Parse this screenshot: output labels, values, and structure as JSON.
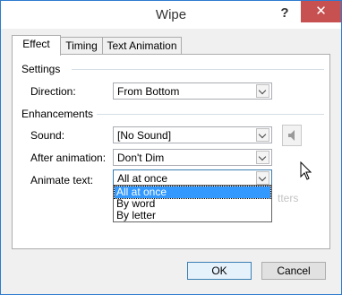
{
  "window": {
    "title": "Wipe",
    "help_label": "?",
    "close_label": "✕"
  },
  "tabs": [
    {
      "label": "Effect",
      "active": true
    },
    {
      "label": "Timing",
      "active": false
    },
    {
      "label": "Text Animation",
      "active": false
    }
  ],
  "settings": {
    "heading": "Settings",
    "direction_label": "Direction:",
    "direction_value": "From Bottom"
  },
  "enhancements": {
    "heading": "Enhancements",
    "sound_label": "Sound:",
    "sound_value": "[No Sound]",
    "sound_icon": "speaker-icon",
    "after_label": "After animation:",
    "after_value": "Don't Dim",
    "animate_label": "Animate text:",
    "animate_value": "All at once",
    "animate_options": [
      "All at once",
      "By word",
      "By letter"
    ],
    "behind_text": "tters"
  },
  "buttons": {
    "ok": "OK",
    "cancel": "Cancel"
  },
  "colors": {
    "close_bg": "#c75050",
    "selection": "#3399ff",
    "accent_border": "#2e7bcf"
  }
}
